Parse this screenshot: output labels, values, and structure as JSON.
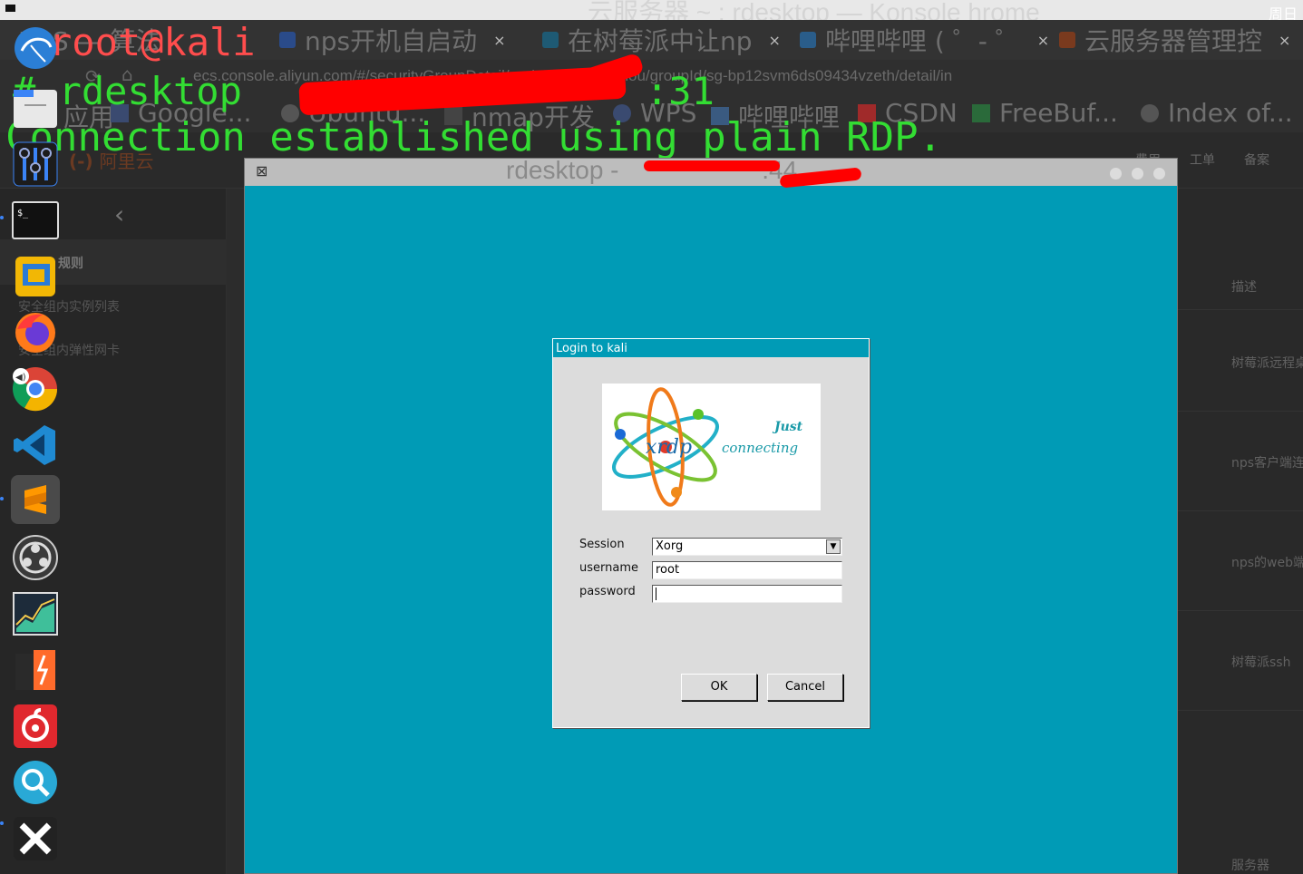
{
  "top_bar": {
    "title": "云服务器 ~ : rdesktop — Konsole hrome",
    "right_label": "周日"
  },
  "browser": {
    "tabs": [
      {
        "label": "NPS — 算法",
        "close": "×"
      },
      {
        "label": "nps开机自启动",
        "close": "×"
      },
      {
        "label": "在树莓派中让np",
        "close": "×"
      },
      {
        "label": "哔哩哔哩 ( ゜- ゜",
        "close": "×"
      },
      {
        "label": "云服务器管理控",
        "close": "×"
      }
    ],
    "url": "ecs.console.aliyun.com/#/securityGroupDetail/region/cn-hangzhou/groupId/sg-bp12svm6ds09434vzeth/detail/in",
    "bookmarks": [
      "应用",
      "Google...",
      "Ubuntu...",
      "nmap开发",
      "WPS",
      "哔哩哔哩",
      "CSDN",
      "FreeBuf...",
      "Index of..."
    ]
  },
  "console": {
    "brand": "阿里云",
    "top_nav": [
      "费用",
      "工单",
      "备案"
    ],
    "sidebar_items": [
      "规则",
      "安全组内实例列表",
      "安全组内弹性网卡"
    ],
    "right_column": [
      "描述",
      "树莓派远程桌",
      "nps客户端连",
      "nps的web端",
      "树莓派ssh",
      "服务器"
    ]
  },
  "terminal": {
    "prompt_user": "root@kali",
    "command": "# rdesktop",
    "port_suffix": ":31",
    "output": "Connection established using plain RDP."
  },
  "dock": {
    "items": [
      "kali-menu",
      "files",
      "mixer",
      "terminal",
      "virtualbox",
      "firefox",
      "chrome",
      "vscode",
      "sublime-text",
      "obs",
      "system-monitor",
      "burpsuite",
      "netease-music",
      "search",
      "xmind"
    ]
  },
  "rdesktop": {
    "title": "rdesktop - ",
    "title_suffix": ".44"
  },
  "login_dialog": {
    "title": "Login to kali",
    "logo_word_1": "Just",
    "logo_word_2": "connecting",
    "logo_brand": "xrdp",
    "session_label": "Session",
    "session_value": "Xorg",
    "username_label": "username",
    "username_value": "root",
    "password_label": "password",
    "ok_label": "OK",
    "cancel_label": "Cancel"
  },
  "colors": {
    "rdp_bg": "#009bb6",
    "terminal_green": "#33dd33",
    "prompt_red": "#ff4d4d"
  }
}
